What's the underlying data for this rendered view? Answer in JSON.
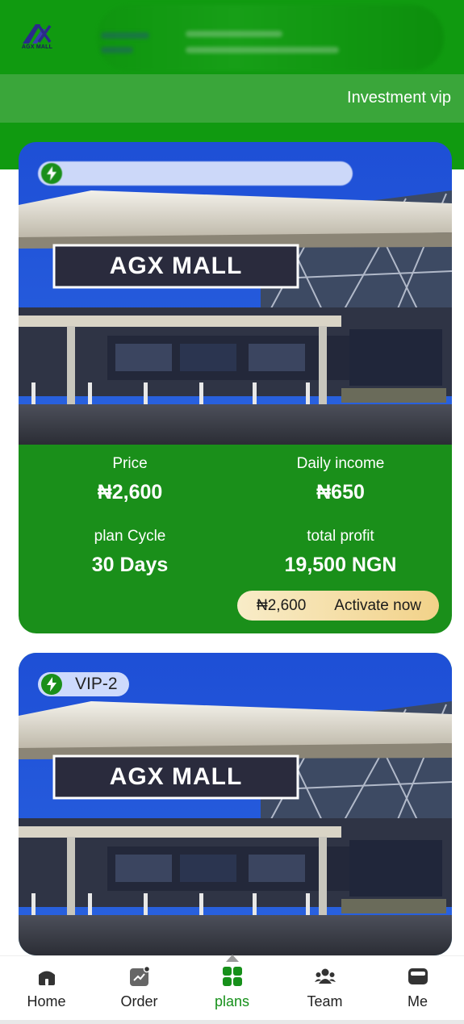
{
  "header": {
    "logo_text": "AGX MALL",
    "page_title": "Investment vip",
    "colors": {
      "primary_green": "#109a10",
      "sub_green": "#3aa63a",
      "card_green": "#1a8f1a",
      "button_gold": "#f2d289"
    }
  },
  "plans": [
    {
      "badge_icon": "lightning-icon",
      "badge_label": "",
      "image_sign": "AGX MALL",
      "price_label": "Price",
      "price_value": "₦2,600",
      "daily_label": "Daily income",
      "daily_value": "₦650",
      "cycle_label": "plan Cycle",
      "cycle_value": "30 Days",
      "profit_label": "total profit",
      "profit_value": "19,500 NGN",
      "button_price": "₦2,600",
      "button_label": "Activate now"
    },
    {
      "badge_icon": "lightning-icon",
      "badge_label": "VIP-2",
      "image_sign": "AGX MALL"
    }
  ],
  "bottom_nav": {
    "items": [
      {
        "label": "Home",
        "icon": "home-icon"
      },
      {
        "label": "Order",
        "icon": "order-icon"
      },
      {
        "label": "plans",
        "icon": "grid-icon",
        "active": true
      },
      {
        "label": "Team",
        "icon": "team-icon"
      },
      {
        "label": "Me",
        "icon": "wallet-icon"
      }
    ]
  }
}
